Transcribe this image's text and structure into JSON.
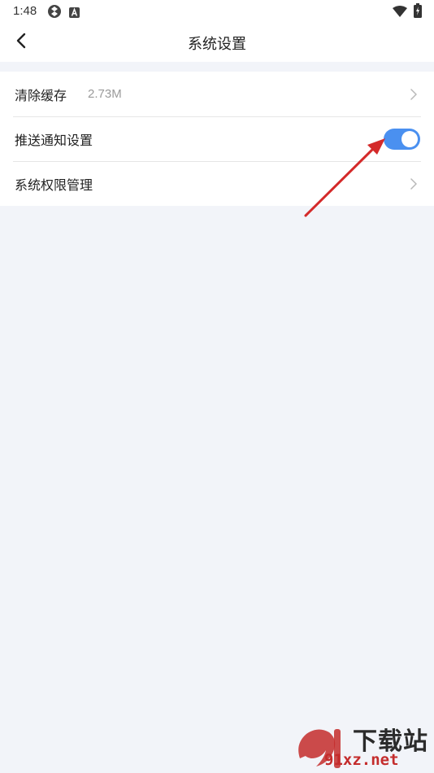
{
  "status_bar": {
    "time": "1:48",
    "icons": [
      "sync-icon",
      "notification-a-icon",
      "wifi-icon",
      "battery-icon"
    ]
  },
  "header": {
    "title": "系统设置",
    "back_icon": "chevron-left-icon"
  },
  "settings": {
    "items": [
      {
        "label": "清除缓存",
        "value": "2.73M",
        "control": "chevron"
      },
      {
        "label": "推送通知设置",
        "control": "toggle",
        "toggle_on": true
      },
      {
        "label": "系统权限管理",
        "control": "chevron"
      }
    ]
  },
  "colors": {
    "background": "#f2f4f9",
    "toggle_on": "#4a90f0",
    "annotation_arrow": "#d42a2a"
  },
  "watermark": {
    "text_top": "下载站",
    "text_bottom": "91xz.net"
  }
}
